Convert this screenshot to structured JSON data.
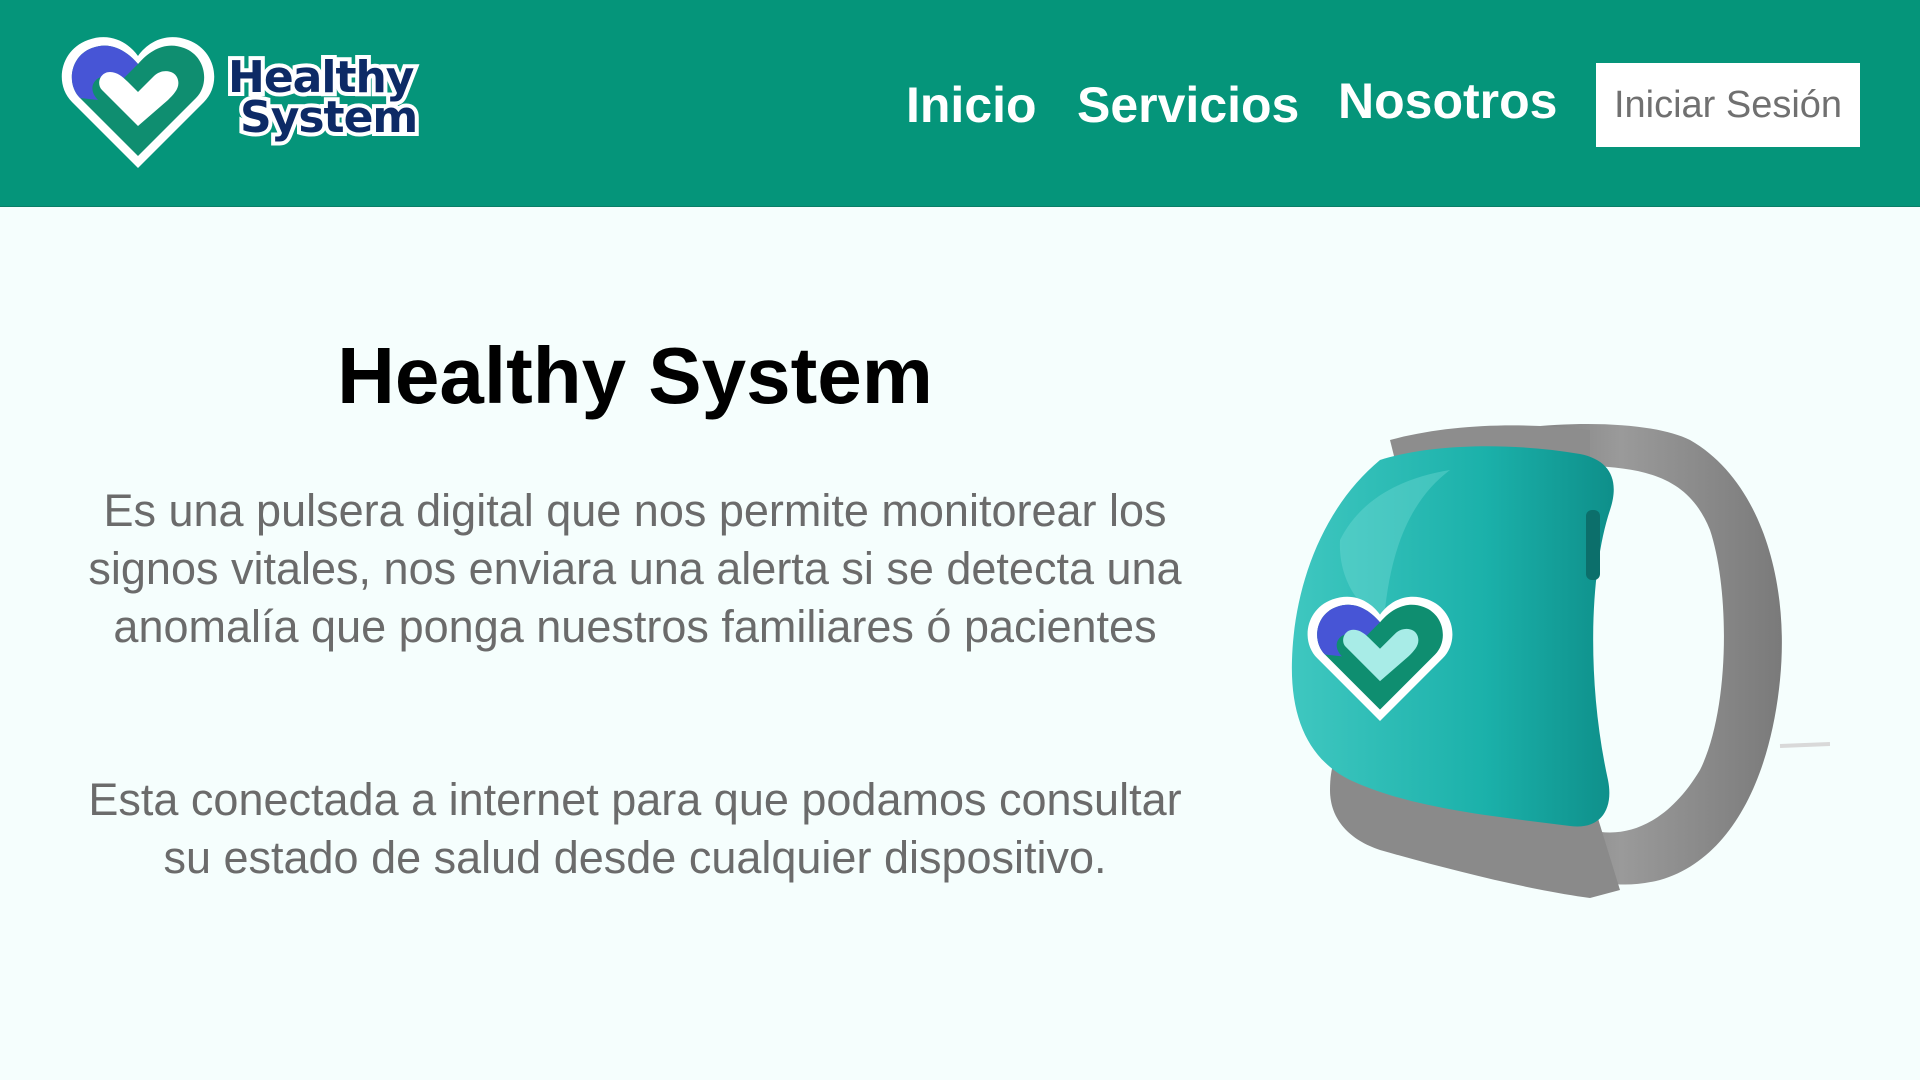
{
  "brand": {
    "name_line1": "Healthy",
    "name_line2": "System",
    "colors": {
      "header": "#05957a",
      "heart_blue": "#4755d6",
      "heart_green": "#0f8e70",
      "logo_text": "#0d2a66"
    }
  },
  "nav": {
    "items": [
      {
        "label": "Inicio"
      },
      {
        "label": "Servicios"
      },
      {
        "label": "Nosotros"
      }
    ],
    "login_label": "Iniciar Sesión"
  },
  "hero": {
    "title": "Healthy System",
    "paragraph1": "Es una pulsera digital que nos permite monitorear los signos vitales, nos enviara una alerta si se detecta una anomalía que ponga nuestros familiares ó pacientes",
    "paragraph2": "Esta conectada a internet para que podamos consultar su estado de salud desde cualquier dispositivo.",
    "image_icon": "wristband-image"
  }
}
